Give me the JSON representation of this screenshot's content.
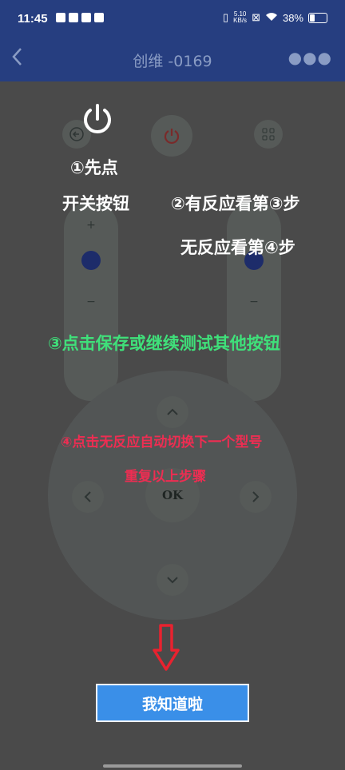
{
  "status_bar": {
    "time": "11:45",
    "speed_value": "5.10",
    "speed_unit": "KB/s",
    "battery": "38%",
    "battery_level": 0.38
  },
  "app_bar": {
    "title": "创维 -0169",
    "back_icon": "chevron-left-icon",
    "more_icon": "more-dots-icon"
  },
  "remote": {
    "plus_label": "+",
    "minus_label": "−",
    "ok_label": "OK"
  },
  "guide": {
    "step1_line1": "①先点",
    "step1_line2": "开关按钮",
    "step2_line1": "②有反应看第③步",
    "step2_line2": "无反应看第④步",
    "step3": "③点击保存或继续测试其他按钮",
    "step4_line1": "④点击无反应自动切换下一个型号",
    "step4_line2": "重复以上步骤",
    "confirm_button": "我知道啦",
    "colors": {
      "step3": "#3fe07a",
      "step4": "#ee2d52",
      "arrow": "#e8222f",
      "button": "#3a8fe8"
    }
  }
}
